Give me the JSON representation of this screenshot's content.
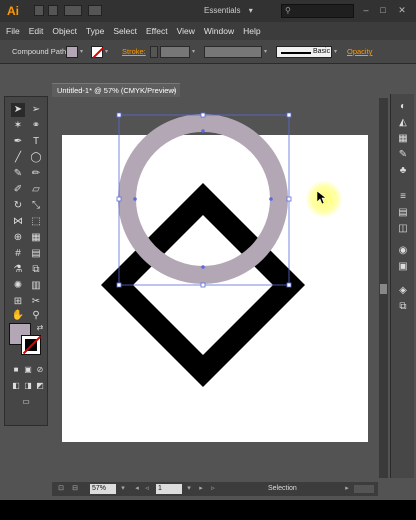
{
  "app": {
    "logo": "Ai",
    "workspace": "Essentials",
    "workspace_arrow": "▾"
  },
  "menu": [
    "File",
    "Edit",
    "Object",
    "Type",
    "Select",
    "Effect",
    "View",
    "Window",
    "Help"
  ],
  "control_bar": {
    "selection_type": "Compound Path",
    "stroke_label": "Stroke:",
    "brush_definition": "Basic",
    "opacity_label": "Opacity"
  },
  "document": {
    "tab_title": "Untitled-1* @ 57% (CMYK/Preview)",
    "close": "×"
  },
  "status_bar": {
    "zoom": "57%",
    "artboard_number": "1",
    "status": "Selection"
  },
  "colors": {
    "fill": "#b3a7b6",
    "stroke": "#000000",
    "accent": "#ff9a00",
    "selection": "#5b6bd8"
  }
}
